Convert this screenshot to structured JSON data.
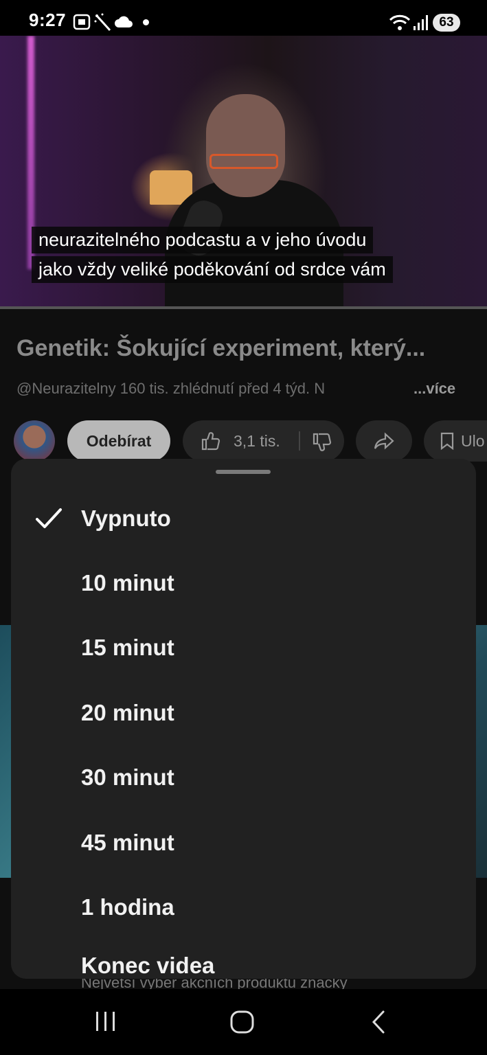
{
  "status_bar": {
    "time": "9:27",
    "battery": "63"
  },
  "video": {
    "captions": [
      "neurazitelného podcastu a v jeho úvodu",
      "jako vždy veliké poděkování od srdce vám"
    ]
  },
  "info": {
    "title": "Genetik: Šokující experiment, který...",
    "meta": "@Neurazitelny  160 tis. zhlédnutí  před 4 týd.  N",
    "more": "...více"
  },
  "actions": {
    "subscribe": "Odebírat",
    "likes": "3,1 tis.",
    "save": "Ulo"
  },
  "sleep_timer_sheet": {
    "selected_index": 0,
    "options": [
      "Vypnuto",
      "10 minut",
      "15 minut",
      "20 minut",
      "30 minut",
      "45 minut",
      "1 hodina",
      "Konec videa"
    ]
  },
  "background": {
    "ad_text": "Největší výběr akčních produktů značky"
  }
}
